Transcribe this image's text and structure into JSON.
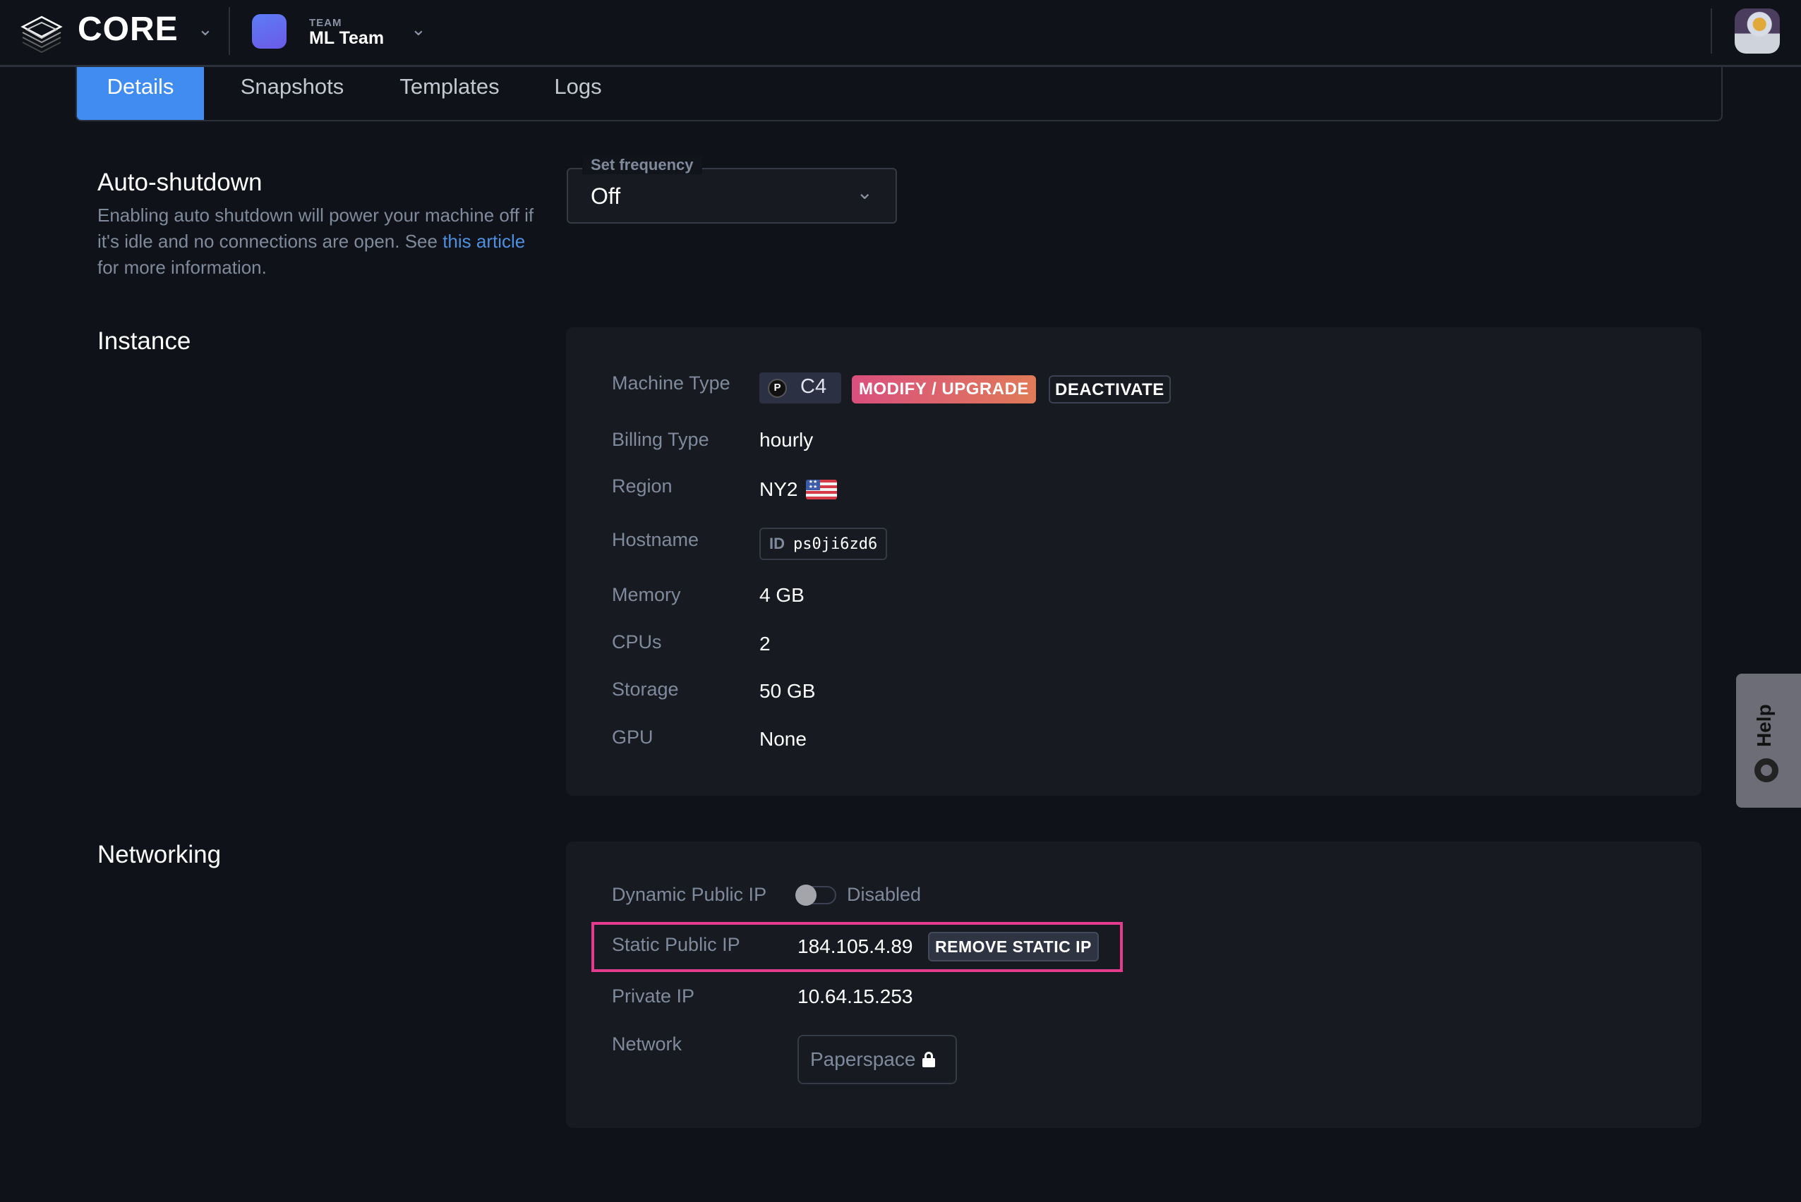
{
  "header": {
    "brand": "CORE",
    "team_caption": "TEAM",
    "team_name": "ML Team"
  },
  "tabs": [
    {
      "label": "Details",
      "active": true
    },
    {
      "label": "Snapshots",
      "active": false
    },
    {
      "label": "Templates",
      "active": false
    },
    {
      "label": "Logs",
      "active": false
    }
  ],
  "auto_shutdown": {
    "title": "Auto-shutdown",
    "desc_before": "Enabling auto shutdown will power your machine off if it's idle and no connections are open. See ",
    "link_text": "this article",
    "desc_after": " for more information.",
    "select_label": "Set frequency",
    "select_value": "Off"
  },
  "instance": {
    "title": "Instance",
    "machine_type_label": "Machine Type",
    "machine_type_value": "C4",
    "modify_button": "MODIFY / UPGRADE",
    "deactivate_button": "DEACTIVATE",
    "billing_label": "Billing Type",
    "billing_value": "hourly",
    "region_label": "Region",
    "region_value": "NY2",
    "hostname_label": "Hostname",
    "hostname_tag": "ID",
    "hostname_value": "ps0ji6zd6",
    "memory_label": "Memory",
    "memory_value": "4 GB",
    "cpus_label": "CPUs",
    "cpus_value": "2",
    "storage_label": "Storage",
    "storage_value": "50 GB",
    "gpu_label": "GPU",
    "gpu_value": "None"
  },
  "networking": {
    "title": "Networking",
    "dynamic_ip_label": "Dynamic Public IP",
    "dynamic_ip_state": "Disabled",
    "static_ip_label": "Static Public IP",
    "static_ip_value": "184.105.4.89",
    "remove_static_button": "REMOVE STATIC IP",
    "private_ip_label": "Private IP",
    "private_ip_value": "10.64.15.253",
    "network_label": "Network",
    "network_value": "Paperspace"
  },
  "help": {
    "label": "Help"
  },
  "colors": {
    "accent": "#418cf0",
    "highlight": "#e43c8c",
    "upgrade_gradient_start": "#d94f7e",
    "upgrade_gradient_end": "#e07b58",
    "background": "#0f1218",
    "panel": "#171a21"
  }
}
